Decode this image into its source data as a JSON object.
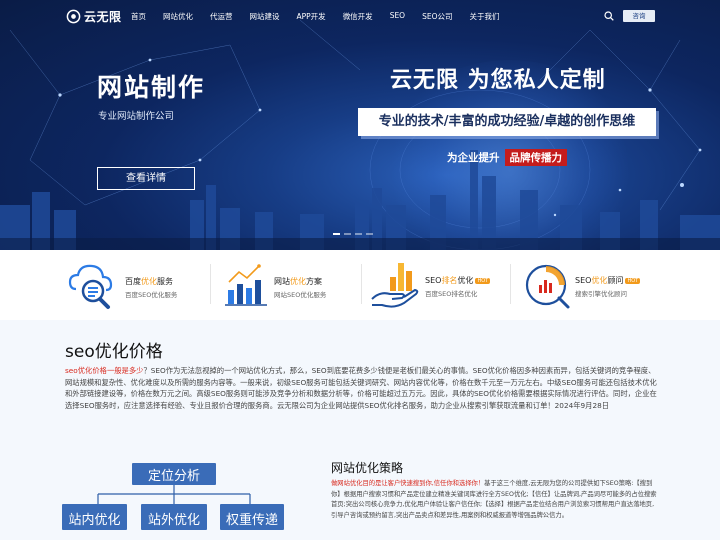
{
  "nav": {
    "logo_text": "云无限",
    "items": [
      "首页",
      "网站优化",
      "代运营",
      "网站建设",
      "APP开发",
      "微信开发",
      "SEO",
      "SEO公司",
      "关于我们"
    ],
    "consult_label": "咨询"
  },
  "hero": {
    "title": "网站制作",
    "subtitle": "专业网站制作公司",
    "button": "查看详情",
    "slogan": "云无限  为您私人定制",
    "box_text": "专业的技术/丰富的成功经验/卓越的创作思维",
    "tagline_a": "为企业提升",
    "tagline_b": "品牌传播力",
    "slide_count": 4,
    "active_slide": 1
  },
  "services": [
    {
      "title_pre": "百度",
      "title_hl": "优化",
      "title_post": "服务",
      "desc": "百度SEO优化服务",
      "tag": "",
      "icon": "cloud-search-icon"
    },
    {
      "title_pre": "网站",
      "title_hl": "优化",
      "title_post": "方案",
      "desc": "网站SEO优化服务",
      "tag": "",
      "icon": "bar-chart-icon"
    },
    {
      "title_pre": "SEO",
      "title_hl": "排名",
      "title_post": "优化",
      "desc": "百度SEO排名优化",
      "tag": "HOT",
      "icon": "hand-chart-icon"
    },
    {
      "title_pre": "SEO",
      "title_hl": "优化",
      "title_post": "顾问",
      "desc": "搜索引擎优化顾问",
      "tag": "HOT",
      "icon": "gauge-chart-icon"
    }
  ],
  "article": {
    "title": "seo优化价格",
    "lead": "seo优化价格一般是多少",
    "body": "？SEO作为无法忽视掉的一个网站优化方式，那么，SEO到底要花费多少钱便是老板们最关心的事情。SEO优化价格因多种因素而异，包括关键词的竞争程度、网站规模和复杂性、优化难度以及所需的服务内容等。一般来说，初级SEO服务可能包括关键词研究、网站内容优化等，价格在数千元至一万元左右。中级SEO服务可能还包括技术优化和外部链接建设等，价格在数万元之间。高级SEO服务则可能涉及竞争分析和数据分析等，价格可能超过五万元。因此，具体的SEO优化价格需要根据实际情况进行评估。同时，企业在选择SEO服务时，应注意选择有经验、专业且报价合理的服务商。云无限公司为企业网站提供SEO优化排名服务，助力企业从搜索引擎获取流量和订单！2024年9月28日"
  },
  "diagram": {
    "top": "定位分析",
    "left": "站内优化",
    "mid": "站外优化",
    "right": "权重传递"
  },
  "strategy": {
    "title": "网站优化策略",
    "lead": "做网站优化目的是让客户快速搜到你,信任你和选择你！",
    "body": "基于这三个维度,云无限为您的公司提供如下SEO策略:【搜到你】根据用户搜索习惯和产品定位建立精准关键词库进行全方SEO优化;【信任】让品牌词,产品词尽可能多的占位搜索首页;突出公司核心竞争力,优化用户体验让客户信任你;【选择】根据产品定位结合用户浏览索习惯帮用户直达落地页,引导户咨询或预约留言,突出产品卖点和差异性,用案例和权威报道等增强品牌公信力。"
  },
  "colors": {
    "hero_bg": "#0d2660",
    "accent_orange": "#f29a1b",
    "accent_red": "#c41c1c",
    "diagram_blue": "#2e5fa8"
  }
}
